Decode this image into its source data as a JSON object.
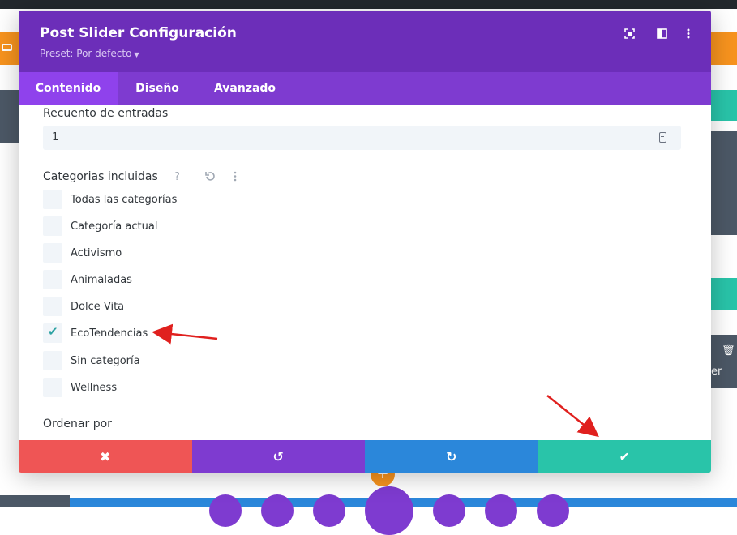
{
  "modal": {
    "title": "Post Slider Configuración",
    "preset": "Preset: Por defecto",
    "header_icons": [
      "fullscreen-icon",
      "split-view-icon",
      "more-options-icon"
    ],
    "tabs": [
      {
        "label": "Contenido",
        "active": true
      },
      {
        "label": "Diseño",
        "active": false
      },
      {
        "label": "Avanzado",
        "active": false
      }
    ]
  },
  "fields": {
    "post_count": {
      "label": "Recuento de entradas",
      "value": "1"
    },
    "categories": {
      "label": "Categorias incluidas",
      "icons": [
        "help-icon",
        "reset-icon",
        "more-options-icon"
      ],
      "items": [
        {
          "label": "Todas las categorías",
          "checked": false
        },
        {
          "label": "Categoría actual",
          "checked": false
        },
        {
          "label": "Activismo",
          "checked": false
        },
        {
          "label": "Animaladas",
          "checked": false
        },
        {
          "label": "Dolce Vita",
          "checked": false
        },
        {
          "label": "EcoTendencias",
          "checked": true
        },
        {
          "label": "Sin categoría",
          "checked": false
        },
        {
          "label": "Wellness",
          "checked": false
        }
      ]
    },
    "order_by": {
      "label": "Ordenar por"
    }
  },
  "footer": {
    "buttons": [
      {
        "name": "discard",
        "icon": "close-icon",
        "glyph": "✖",
        "color": "#ef5555"
      },
      {
        "name": "undo",
        "icon": "undo-icon",
        "glyph": "↺",
        "color": "#7e3bd0"
      },
      {
        "name": "redo",
        "icon": "redo-icon",
        "glyph": "↻",
        "color": "#2b87da"
      },
      {
        "name": "save",
        "icon": "checkmark-icon",
        "glyph": "✔",
        "color": "#29c4a9"
      }
    ]
  },
  "background": {
    "partial_text": "er"
  },
  "colors": {
    "header": "#6c2eb9",
    "tabs": "#7e3bd0",
    "active_tab": "#8f42ec",
    "annotation_arrow": "#e0201e"
  }
}
